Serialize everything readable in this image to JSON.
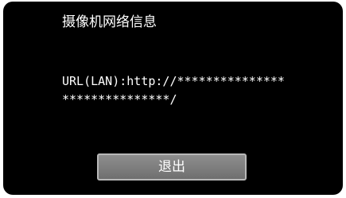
{
  "dialog": {
    "title": "摄像机网络信息",
    "url_line_1": "URL(LAN):http://***************",
    "url_line_2": "***************/",
    "exit_label": "退出"
  }
}
